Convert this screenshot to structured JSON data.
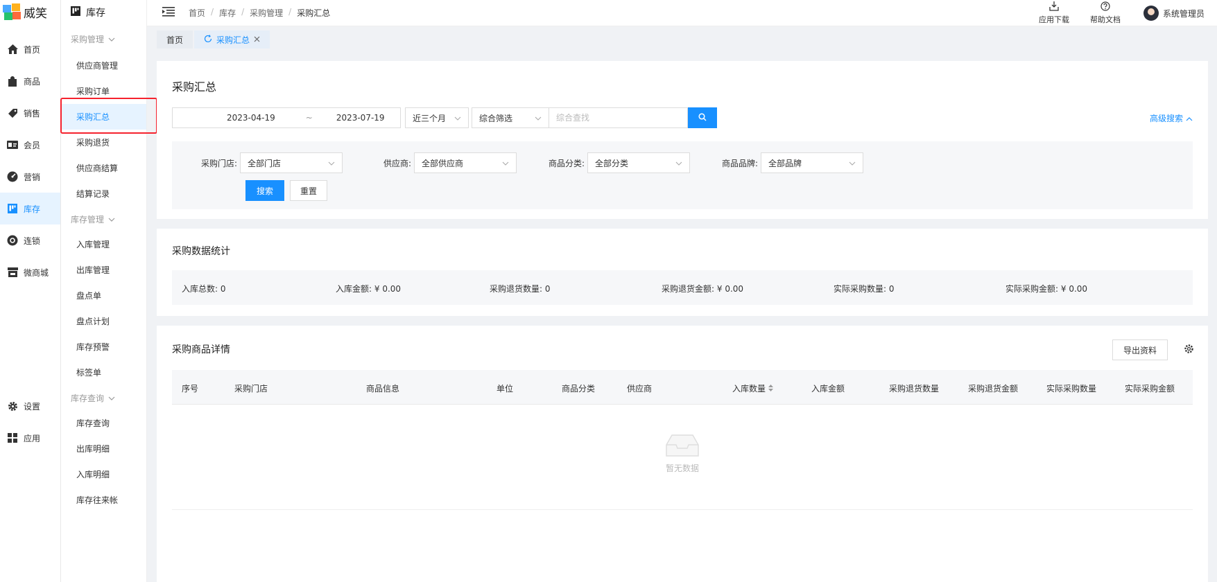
{
  "brand": {
    "name": "威笑"
  },
  "rail": {
    "items": [
      {
        "label": "首页",
        "icon": "home-icon"
      },
      {
        "label": "商品",
        "icon": "shopping-bag-icon"
      },
      {
        "label": "销售",
        "icon": "tag-icon"
      },
      {
        "label": "会员",
        "icon": "member-card-icon"
      },
      {
        "label": "营销",
        "icon": "dashboard-icon"
      },
      {
        "label": "库存",
        "icon": "inventory-icon"
      },
      {
        "label": "连锁",
        "icon": "chain-icon"
      },
      {
        "label": "微商城",
        "icon": "store-icon"
      }
    ],
    "bottom": [
      {
        "label": "设置",
        "icon": "gear-icon"
      },
      {
        "label": "应用",
        "icon": "apps-grid-icon"
      }
    ]
  },
  "subnav": {
    "title": "库存",
    "groups": [
      {
        "title": "采购管理",
        "items": [
          "供应商管理",
          "采购订单",
          "采购汇总",
          "采购退货",
          "供应商结算",
          "结算记录"
        ]
      },
      {
        "title": "库存管理",
        "items": [
          "入库管理",
          "出库管理",
          "盘点单",
          "盘点计划",
          "库存预警",
          "标签单"
        ]
      },
      {
        "title": "库存查询",
        "items": [
          "库存查询",
          "出库明细",
          "入库明细",
          "库存往来帐"
        ]
      }
    ]
  },
  "breadcrumb": {
    "items": [
      "首页",
      "库存",
      "采购管理",
      "采购汇总"
    ]
  },
  "header": {
    "download": "应用下载",
    "help": "帮助文档",
    "user": "系统管理员"
  },
  "tabs": [
    {
      "label": "首页"
    },
    {
      "label": "采购汇总"
    }
  ],
  "summary": {
    "title": "采购汇总",
    "date_start": "2023-04-19",
    "date_sep": "~",
    "date_end": "2023-07-19",
    "period": "近三个月",
    "filter": "综合筛选",
    "search_placeholder": "综合查找",
    "advanced": "高级搜索",
    "fields": [
      {
        "label": "采购门店:",
        "value": "全部门店"
      },
      {
        "label": "供应商:",
        "value": "全部供应商"
      },
      {
        "label": "商品分类:",
        "value": "全部分类"
      },
      {
        "label": "商品品牌:",
        "value": "全部品牌"
      }
    ],
    "search_btn": "搜索",
    "reset_btn": "重置"
  },
  "stats": {
    "title": "采购数据统计",
    "items": [
      {
        "label": "入库总数:",
        "value": "0"
      },
      {
        "label": "入库金额:",
        "value": "¥ 0.00"
      },
      {
        "label": "采购退货数量:",
        "value": "0"
      },
      {
        "label": "采购退货金额:",
        "value": "¥ 0.00"
      },
      {
        "label": "实际采购数量:",
        "value": "0"
      },
      {
        "label": "实际采购金额:",
        "value": "¥ 0.00"
      }
    ]
  },
  "detail": {
    "title": "采购商品详情",
    "export": "导出资料",
    "columns": [
      "序号",
      "采购门店",
      "商品信息",
      "单位",
      "商品分类",
      "供应商",
      "入库数量",
      "入库金额",
      "采购退货数量",
      "采购退货金额",
      "实际采购数量",
      "实际采购金额"
    ],
    "empty": "暂无数据"
  }
}
